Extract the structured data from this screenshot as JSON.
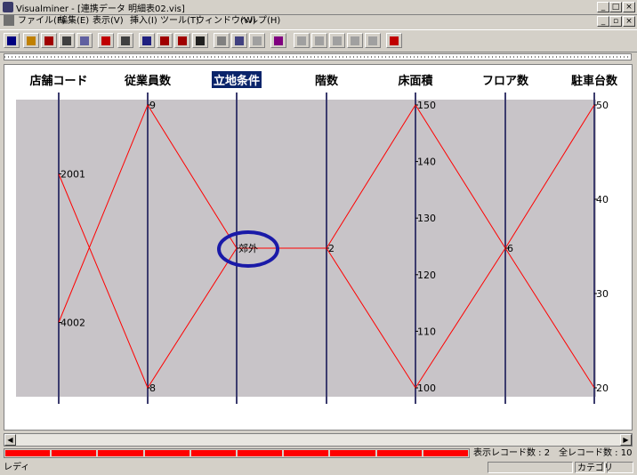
{
  "window": {
    "title": "Visualminer - [連携データ 明細表02.vis]",
    "buttons": [
      "_",
      "□",
      "×"
    ],
    "doc_buttons": [
      "_",
      "▫",
      "×"
    ]
  },
  "menu": [
    "ファイル(F)",
    "編集(E)",
    "表示(V)",
    "挿入(I)",
    "ツール(T)",
    "ウィンドウ(W)",
    "ヘルプ(H)"
  ],
  "toolbar": {
    "buttons": [
      {
        "icon": "import-icon",
        "color": "#000080"
      },
      {
        "icon": "open-icon",
        "color": "#c08000"
      },
      {
        "icon": "save-icon",
        "color": "#a00000"
      },
      {
        "icon": "print-icon",
        "color": "#404040"
      },
      {
        "icon": "table-icon",
        "color": "#6060a0"
      },
      {
        "icon": "bar-chart-icon",
        "color": "#c00000"
      },
      {
        "icon": "report-icon",
        "color": "#404040"
      },
      {
        "icon": "parallel-plot-icon",
        "color": "#202080"
      },
      {
        "icon": "cross-plot-icon",
        "color": "#a00000"
      },
      {
        "icon": "matrix-icon",
        "color": "#a00000"
      },
      {
        "icon": "grid-icon",
        "color": "#202020"
      },
      {
        "icon": "zoom-in-icon",
        "color": "#808080"
      },
      {
        "icon": "zoom-range-icon",
        "color": "#404080"
      },
      {
        "icon": "zoom-out-icon",
        "color": "#a0a0a0"
      },
      {
        "icon": "axis-icon",
        "color": "#800080"
      },
      {
        "icon": "property-icon",
        "color": "#a0a0a0"
      },
      {
        "icon": "list-icon",
        "color": "#a0a0a0"
      },
      {
        "icon": "pen-icon",
        "color": "#a0a0a0"
      },
      {
        "icon": "document-icon",
        "color": "#a0a0a0"
      },
      {
        "icon": "export-icon",
        "color": "#a0a0a0"
      },
      {
        "icon": "tfp-icon",
        "color": "#c00000"
      }
    ]
  },
  "chart_data": {
    "type": "parallel-coordinates",
    "axes": [
      {
        "name": "店舗コード",
        "kind": "category",
        "labels": [
          {
            "text": "2001",
            "pos": 0.75
          },
          {
            "text": "4002",
            "pos": 0.25
          }
        ]
      },
      {
        "name": "従業員数",
        "kind": "numeric",
        "min": 8,
        "max": 9,
        "ticks": [
          {
            "text": "9",
            "value": 9
          },
          {
            "text": "8",
            "value": 8
          }
        ]
      },
      {
        "name": "立地条件",
        "kind": "category",
        "selected": true,
        "labels": [
          {
            "text": "郊外",
            "pos": 0.5
          }
        ]
      },
      {
        "name": "階数",
        "kind": "category",
        "labels": [
          {
            "text": "2",
            "pos": 0.5
          }
        ]
      },
      {
        "name": "床面積",
        "kind": "numeric",
        "min": 100,
        "max": 150,
        "ticks": [
          {
            "text": "150",
            "value": 150
          },
          {
            "text": "140",
            "value": 140
          },
          {
            "text": "130",
            "value": 130
          },
          {
            "text": "120",
            "value": 120
          },
          {
            "text": "110",
            "value": 110
          },
          {
            "text": "100",
            "value": 100
          }
        ]
      },
      {
        "name": "フロア数",
        "kind": "category",
        "labels": [
          {
            "text": "6",
            "pos": 0.5
          }
        ]
      },
      {
        "name": "駐車台数",
        "kind": "numeric",
        "min": 20,
        "max": 50,
        "ticks": [
          {
            "text": "50",
            "value": 50
          },
          {
            "text": "40",
            "value": 40
          },
          {
            "text": "30",
            "value": 30
          },
          {
            "text": "20",
            "value": 20
          }
        ]
      }
    ],
    "records": [
      {
        "店舗コード": "2001",
        "従業員数": 8,
        "立地条件": "郊外",
        "階数": "2",
        "床面積": 150,
        "フロア数": "6",
        "駐車台数": 20
      },
      {
        "店舗コード": "4002",
        "従業員数": 9,
        "立地条件": "郊外",
        "階数": "2",
        "床面積": 100,
        "フロア数": "6",
        "駐車台数": 50
      }
    ],
    "line_color": "#ff0000",
    "axis_color": "#3c3c6e",
    "plot_background": "#c8c4c8",
    "highlight": {
      "axis": "立地条件",
      "label": "郊外",
      "color": "#1a1aa8"
    }
  },
  "status": {
    "progress_segments": 10,
    "display_records": "表示レコード数 : 2",
    "total_records": "全レコード数 : 10",
    "ready": "レディ",
    "mode": "カテゴリ"
  }
}
